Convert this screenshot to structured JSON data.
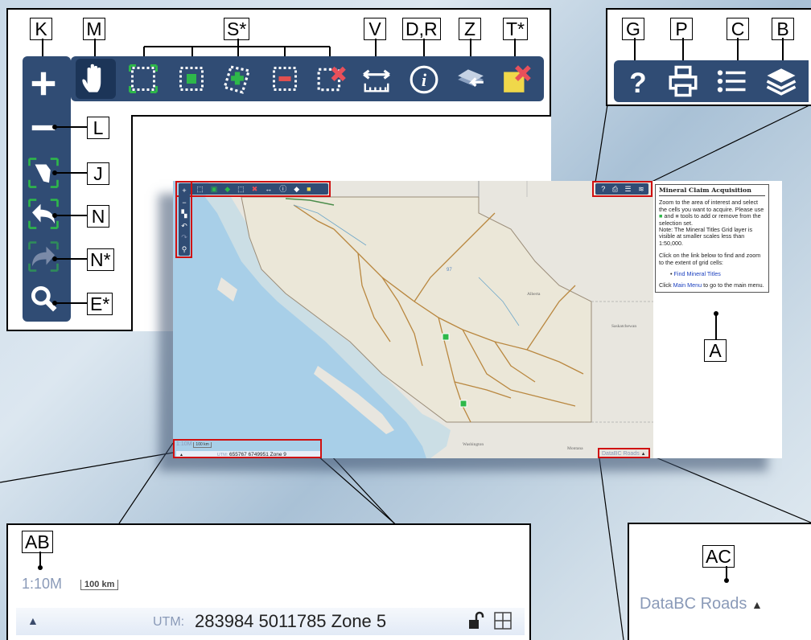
{
  "callouts": {
    "K": "K",
    "M": "M",
    "S": "S*",
    "V": "V",
    "DR": "D,R",
    "Z": "Z",
    "T": "T*",
    "G": "G",
    "P": "P",
    "C": "C",
    "B": "B",
    "L": "L",
    "J": "J",
    "N": "N",
    "Nstar": "N*",
    "E": "E*",
    "A": "A",
    "AB": "AB",
    "AC": "AC"
  },
  "toolbar": {
    "icons": [
      "pan-hand",
      "select-rectangle",
      "add-cells",
      "add-polygon",
      "remove-cells",
      "clear-selection",
      "measure",
      "identify",
      "zoom-previous",
      "clear-all"
    ]
  },
  "side_toolbar": {
    "icons": [
      "zoom-in",
      "zoom-out",
      "zoom-extent",
      "back",
      "forward",
      "search"
    ]
  },
  "right_toolbar": {
    "icons": [
      "help",
      "print",
      "legend",
      "layers"
    ]
  },
  "panel": {
    "title": "Mineral Claim Acquisition",
    "p1": "Zoom to the area of interest and select the cells you want to acquire. Please use",
    "p1b": "and",
    "p1c": "tools to add or remove from the selection set.",
    "note": "Note: The Mineral Titles Grid layer is visible at smaller scales less than 1:50,000.",
    "p2": "Click on the link below to find and zoom to the extent of grid cells:",
    "link": "Find Mineral Titles",
    "p3a": "Click",
    "p3link": "Main Menu",
    "p3b": "to go to the main menu."
  },
  "map": {
    "labels": {
      "alberta": "Alberta",
      "saskatchewan": "Saskatchewan",
      "washington": "Washington",
      "montana": "Montana"
    },
    "scale_small": "1:10M",
    "scalebar_small": "100 km",
    "utm_small_label": "UTM:",
    "utm_small_value": "655767 6749951 Zone 9",
    "basemap": "DataBC Roads"
  },
  "zoom_bottom_left": {
    "scale": "1:10M",
    "scalebar": "100 km",
    "utm_label": "UTM:",
    "utm_value": "283984 5011785 Zone 5"
  },
  "zoom_bottom_right": {
    "basemap": "DataBC Roads"
  }
}
